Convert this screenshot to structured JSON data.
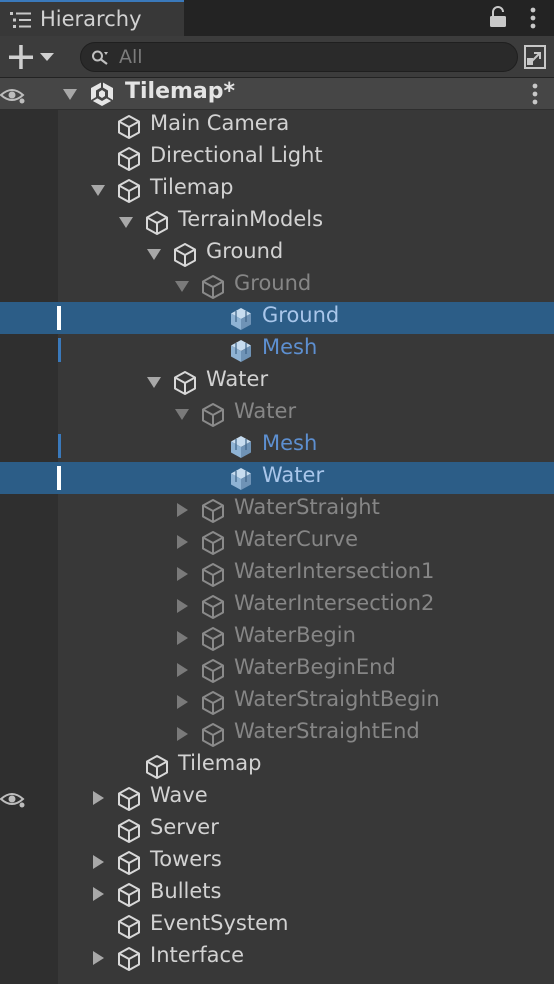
{
  "panel": {
    "title": "Hierarchy",
    "search_placeholder": "All"
  },
  "scene": {
    "name": "Tilemap*"
  },
  "colors": {
    "selection": "#2c5d87",
    "accent": "#3a79bb",
    "prefab_blue": "#5d8fd0"
  },
  "rows": [
    {
      "label": "Main Camera",
      "depth": 1,
      "arrow": "none",
      "icon": "cube",
      "color": "normal"
    },
    {
      "label": "Directional Light",
      "depth": 1,
      "arrow": "none",
      "icon": "cube",
      "color": "normal"
    },
    {
      "label": "Tilemap",
      "depth": 1,
      "arrow": "down",
      "icon": "cube",
      "color": "normal"
    },
    {
      "label": "TerrainModels",
      "depth": 2,
      "arrow": "down",
      "icon": "cube",
      "color": "normal"
    },
    {
      "label": "Ground",
      "depth": 3,
      "arrow": "down",
      "icon": "cube",
      "color": "normal"
    },
    {
      "label": "Ground",
      "depth": 4,
      "arrow": "down",
      "icon": "cube",
      "color": "dim"
    },
    {
      "label": "Ground",
      "depth": 5,
      "arrow": "none",
      "icon": "prefab",
      "color": "bright",
      "state": "selected"
    },
    {
      "label": "Mesh",
      "depth": 5,
      "arrow": "none",
      "icon": "prefab",
      "color": "blue",
      "state": "sub"
    },
    {
      "label": "Water",
      "depth": 3,
      "arrow": "down",
      "icon": "cube",
      "color": "normal"
    },
    {
      "label": "Water",
      "depth": 4,
      "arrow": "down",
      "icon": "cube",
      "color": "dim"
    },
    {
      "label": "Mesh",
      "depth": 5,
      "arrow": "none",
      "icon": "prefab",
      "color": "blue",
      "state": "sub"
    },
    {
      "label": "Water",
      "depth": 5,
      "arrow": "none",
      "icon": "prefab",
      "color": "bright",
      "state": "selected"
    },
    {
      "label": "WaterStraight",
      "depth": 4,
      "arrow": "right",
      "icon": "cube",
      "color": "dim"
    },
    {
      "label": "WaterCurve",
      "depth": 4,
      "arrow": "right",
      "icon": "cube",
      "color": "dim"
    },
    {
      "label": "WaterIntersection1",
      "depth": 4,
      "arrow": "right",
      "icon": "cube",
      "color": "dim"
    },
    {
      "label": "WaterIntersection2",
      "depth": 4,
      "arrow": "right",
      "icon": "cube",
      "color": "dim"
    },
    {
      "label": "WaterBegin",
      "depth": 4,
      "arrow": "right",
      "icon": "cube",
      "color": "dim"
    },
    {
      "label": "WaterBeginEnd",
      "depth": 4,
      "arrow": "right",
      "icon": "cube",
      "color": "dim"
    },
    {
      "label": "WaterStraightBegin",
      "depth": 4,
      "arrow": "right",
      "icon": "cube",
      "color": "dim"
    },
    {
      "label": "WaterStraightEnd",
      "depth": 4,
      "arrow": "right",
      "icon": "cube",
      "color": "dim"
    },
    {
      "label": "Tilemap",
      "depth": 2,
      "arrow": "none",
      "icon": "cube",
      "color": "normal"
    },
    {
      "label": "Wave",
      "depth": 1,
      "arrow": "right",
      "icon": "cube",
      "color": "normal",
      "eye": true
    },
    {
      "label": "Server",
      "depth": 1,
      "arrow": "none",
      "icon": "cube",
      "color": "normal"
    },
    {
      "label": "Towers",
      "depth": 1,
      "arrow": "right",
      "icon": "cube",
      "color": "normal"
    },
    {
      "label": "Bullets",
      "depth": 1,
      "arrow": "right",
      "icon": "cube",
      "color": "normal"
    },
    {
      "label": "EventSystem",
      "depth": 1,
      "arrow": "none",
      "icon": "cube",
      "color": "normal"
    },
    {
      "label": "Interface",
      "depth": 1,
      "arrow": "right",
      "icon": "cube",
      "color": "normal"
    }
  ]
}
